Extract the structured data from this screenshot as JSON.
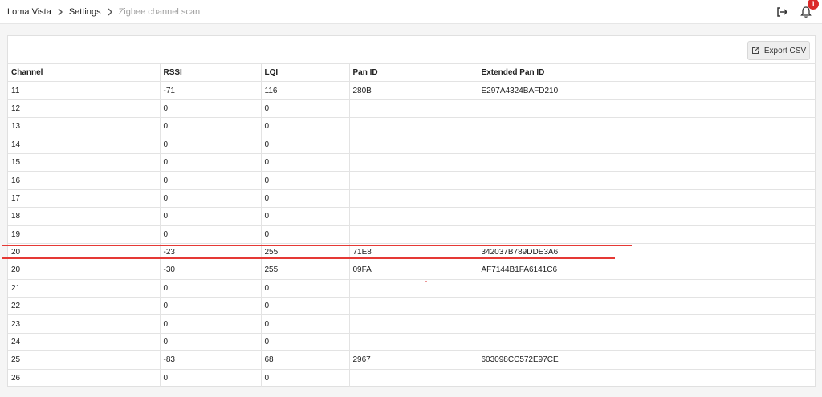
{
  "breadcrumb": {
    "items": [
      "Loma Vista",
      "Settings",
      "Zigbee channel scan"
    ]
  },
  "header": {
    "notification_count": "1",
    "icons": [
      "logout-icon",
      "bell-icon"
    ]
  },
  "toolbar": {
    "export_label": "Export CSV"
  },
  "table": {
    "columns": [
      "Channel",
      "RSSI",
      "LQI",
      "Pan ID",
      "Extended Pan ID"
    ],
    "rows": [
      [
        "11",
        "-71",
        "116",
        "280B",
        "E297A4324BAFD210"
      ],
      [
        "12",
        "0",
        "0",
        "",
        ""
      ],
      [
        "13",
        "0",
        "0",
        "",
        ""
      ],
      [
        "14",
        "0",
        "0",
        "",
        ""
      ],
      [
        "15",
        "0",
        "0",
        "",
        ""
      ],
      [
        "16",
        "0",
        "0",
        "",
        ""
      ],
      [
        "17",
        "0",
        "0",
        "",
        ""
      ],
      [
        "18",
        "0",
        "0",
        "",
        ""
      ],
      [
        "19",
        "0",
        "0",
        "",
        ""
      ],
      [
        "20",
        "-23",
        "255",
        "71E8",
        "342037B789DDE3A6"
      ],
      [
        "20",
        "-30",
        "255",
        "09FA",
        "AF7144B1FA6141C6"
      ],
      [
        "21",
        "0",
        "0",
        "",
        ""
      ],
      [
        "22",
        "0",
        "0",
        "",
        ""
      ],
      [
        "23",
        "0",
        "0",
        "",
        ""
      ],
      [
        "24",
        "0",
        "0",
        "",
        ""
      ],
      [
        "25",
        "-83",
        "68",
        "2967",
        "603098CC572E97CE"
      ],
      [
        "26",
        "0",
        "0",
        "",
        ""
      ]
    ]
  },
  "colors": {
    "annotation": "#e53935",
    "badge": "#db2828"
  }
}
